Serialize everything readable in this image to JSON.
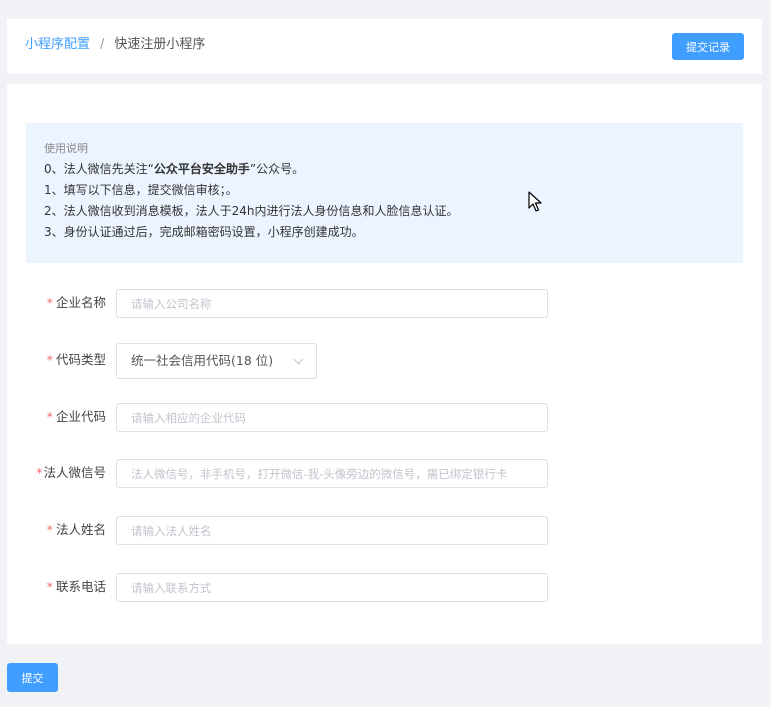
{
  "breadcrumb": {
    "parent": "小程序配置",
    "separator": "/",
    "current": "快速注册小程序"
  },
  "header": {
    "record_button": "提交记录"
  },
  "notice": {
    "title": "使用说明",
    "line0_prefix": "0、法人微信先关注“",
    "line0_bold": "公众平台安全助手",
    "line0_suffix": "”公众号。",
    "line1": "1、填写以下信息，提交微信审核；。",
    "line2": "2、法人微信收到消息模板，法人于24h内进行法人身份信息和人脸信息认证。",
    "line3": "3、身份认证通过后，完成邮箱密码设置，小程序创建成功。"
  },
  "form": {
    "required_mark": "*",
    "company_name": {
      "label": "企业名称",
      "placeholder": "请输入公司名称"
    },
    "code_type": {
      "label": "代码类型",
      "value": "统一社会信用代码(18 位)"
    },
    "company_code": {
      "label": "企业代码",
      "placeholder": "请输入相应的企业代码"
    },
    "legal_wechat": {
      "label": "法人微信号",
      "placeholder": "法人微信号，非手机号，打开微信-我-头像旁边的微信号，需已绑定银行卡"
    },
    "legal_name": {
      "label": "法人姓名",
      "placeholder": "请输入法人姓名"
    },
    "phone": {
      "label": "联系电话",
      "placeholder": "请输入联系方式"
    }
  },
  "footer": {
    "submit_button": "提交"
  },
  "colors": {
    "accent": "#409eff",
    "required": "#f56c6c",
    "notice_bg": "#ecf5ff"
  }
}
